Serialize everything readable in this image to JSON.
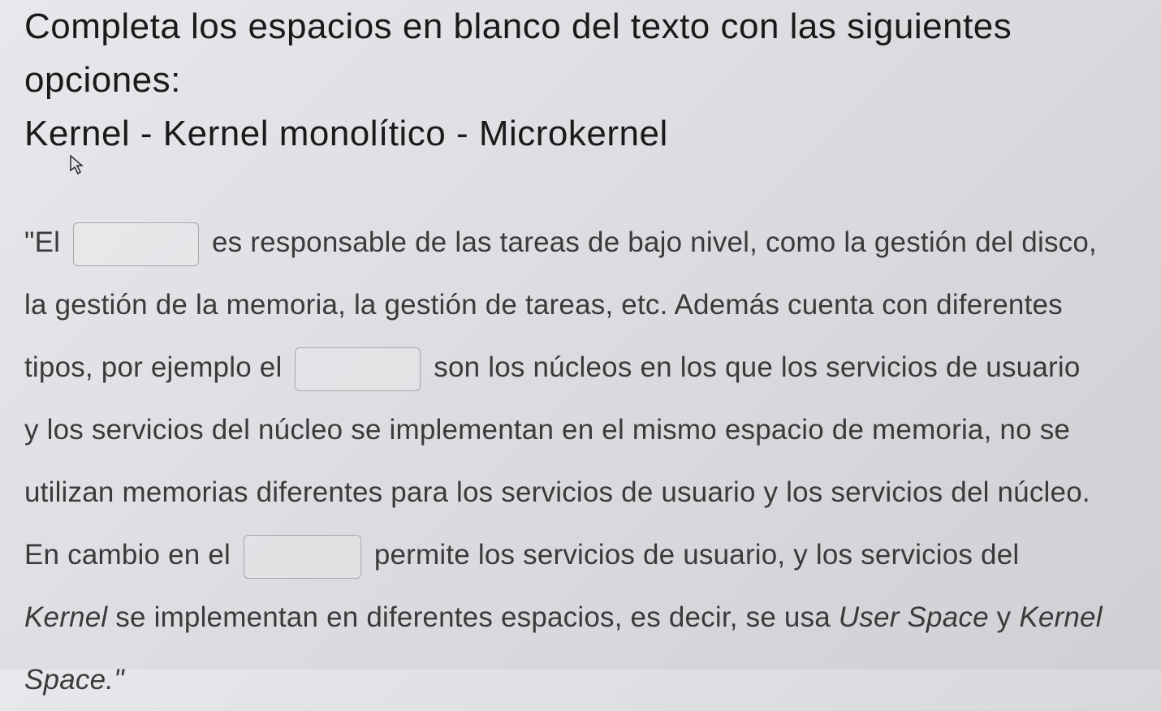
{
  "instruction": {
    "line1": "Completa los espacios en blanco del  texto con las siguientes",
    "line2": "opciones:",
    "options": "Kernel - Kernel monolítico - Microkernel"
  },
  "paragraph": {
    "seg1_prefix": "\"El ",
    "seg1_suffix": " es responsable de las tareas de bajo nivel, como la gestión del disco,",
    "seg2": "la gestión de la memoria, la gestión de tareas, etc. Además cuenta con diferentes",
    "seg3_prefix": "tipos, por ejemplo el ",
    "seg3_suffix": " son los núcleos en los que los servicios de usuario",
    "seg4": "y los servicios del núcleo se implementan en el mismo espacio de memoria, no se",
    "seg5": "utilizan memorias diferentes para los servicios de usuario y los servicios del núcleo.",
    "seg6_prefix": "En cambio en el ",
    "seg6_suffix": " permite los servicios de usuario, y los servicios del",
    "seg7_kernel": "Kernel",
    "seg7_mid": " se implementan en diferentes espacios, es decir, se usa ",
    "seg7_userspace": "User Space",
    "seg7_y": " y ",
    "seg7_kernelspace": "Kernel",
    "seg8_space": "Space.\""
  },
  "blanks": {
    "blank1_value": "",
    "blank2_value": "",
    "blank3_value": ""
  }
}
